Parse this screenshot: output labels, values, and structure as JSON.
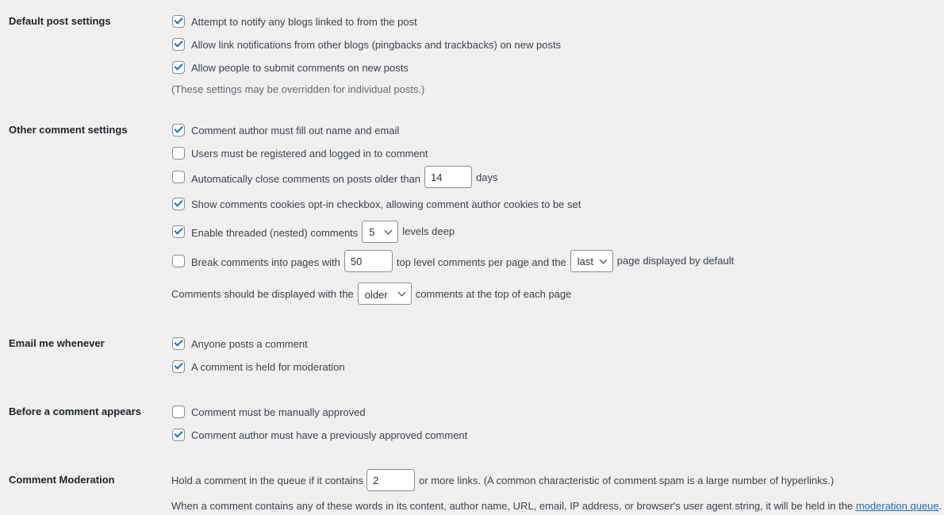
{
  "default_post": {
    "heading": "Default post settings",
    "options": [
      {
        "label": "Attempt to notify any blogs linked to from the post",
        "checked": true
      },
      {
        "label": "Allow link notifications from other blogs (pingbacks and trackbacks) on new posts",
        "checked": true
      },
      {
        "label": "Allow people to submit comments on new posts",
        "checked": true
      }
    ],
    "note": "(These settings may be overridden for individual posts.)"
  },
  "other_comment": {
    "heading": "Other comment settings",
    "require_name_email": {
      "label": "Comment author must fill out name and email",
      "checked": true
    },
    "registered_only": {
      "label": "Users must be registered and logged in to comment",
      "checked": false
    },
    "auto_close": {
      "label_before": "Automatically close comments on posts older than",
      "value": "14",
      "label_after": "days",
      "checked": false
    },
    "cookies_optin": {
      "label": "Show comments cookies opt-in checkbox, allowing comment author cookies to be set",
      "checked": true
    },
    "threaded": {
      "label_before": "Enable threaded (nested) comments",
      "value": "5",
      "label_after": "levels deep",
      "checked": true
    },
    "paged": {
      "label_before": "Break comments into pages with",
      "value": "50",
      "label_middle": "top level comments per page and the",
      "page_value": "last",
      "label_after": "page displayed by default",
      "checked": false
    },
    "order": {
      "label_before": "Comments should be displayed with the",
      "value": "older",
      "label_after": "comments at the top of each page"
    }
  },
  "email_me": {
    "heading": "Email me whenever",
    "options": [
      {
        "label": "Anyone posts a comment",
        "checked": true
      },
      {
        "label": "A comment is held for moderation",
        "checked": true
      }
    ]
  },
  "before_appears": {
    "heading": "Before a comment appears",
    "options": [
      {
        "label": "Comment must be manually approved",
        "checked": false
      },
      {
        "label": "Comment author must have a previously approved comment",
        "checked": true
      }
    ]
  },
  "moderation": {
    "heading": "Comment Moderation",
    "links_before": "Hold a comment in the queue if it contains",
    "links_value": "2",
    "links_after": "or more links. (A common characteristic of comment spam is a large number of hyperlinks.)",
    "words_text": "When a comment contains any of these words in its content, author name, URL, email, IP address, or browser's user agent string, it will be held in the",
    "queue_link": "moderation queue",
    "period": "."
  },
  "colors": {
    "accent": "#2271b1",
    "background": "#f0f0f1",
    "text": "#3c434a"
  }
}
